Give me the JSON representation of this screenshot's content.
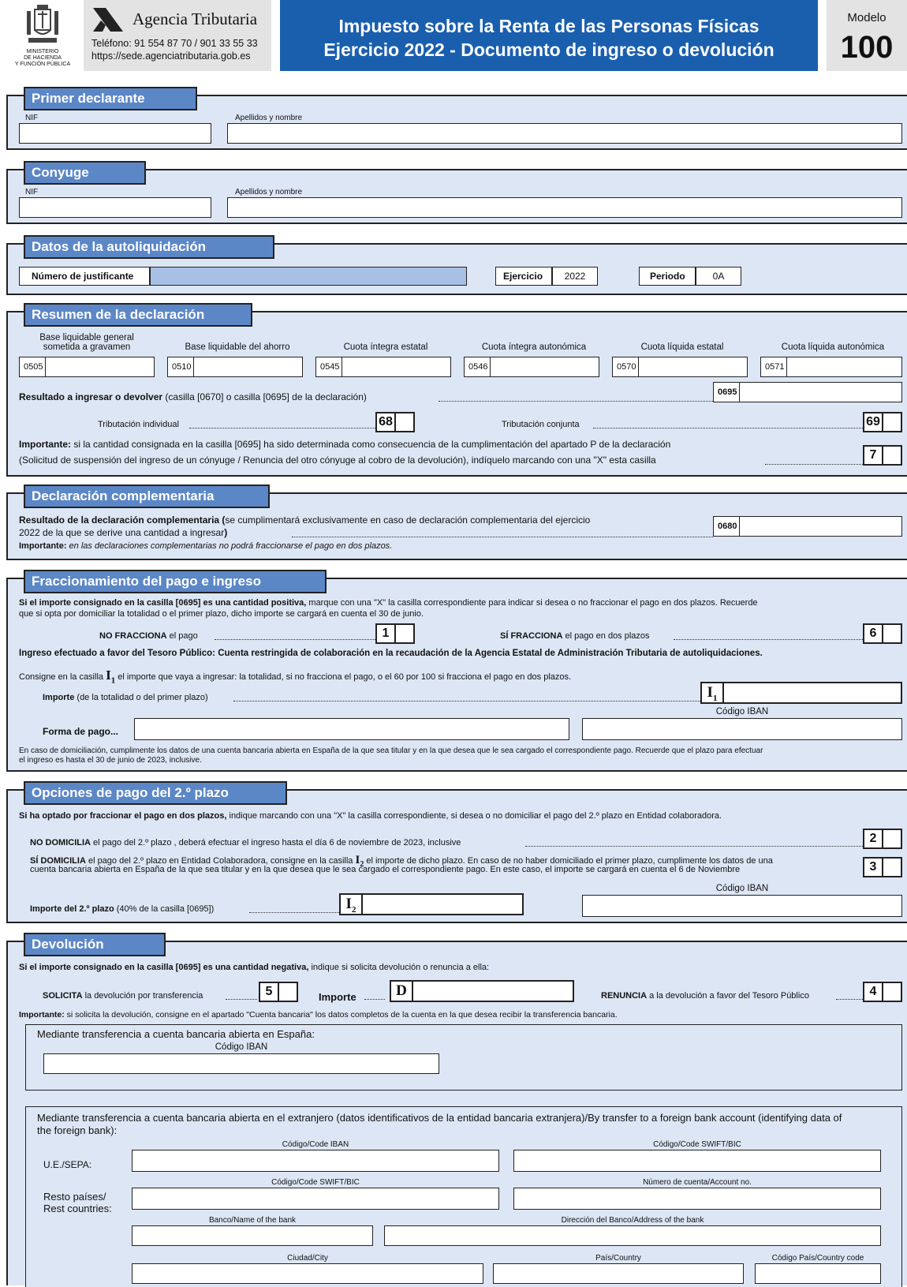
{
  "header": {
    "ministry_line1": "MINISTERIO",
    "ministry_line2": "DE HACIENDA",
    "ministry_line3": "Y FUNCIÓN PÚBLICA",
    "agency_name": "Agencia Tributaria",
    "phone": "Teléfono: 91 554 87 70 / 901 33 55 33",
    "website": "https://sede.agenciatributaria.gob.es",
    "title_line1": "Impuesto sobre la Renta de las Personas Físicas",
    "title_line2": "Ejercicio 2022 - Documento de ingreso o devolución",
    "modelo_label": "Modelo",
    "modelo_number": "100"
  },
  "primer_declarante": {
    "title": "Primer declarante",
    "nif_label": "NIF",
    "name_label": "Apellidos y nombre",
    "nif_value": "",
    "name_value": ""
  },
  "conyuge": {
    "title": "Conyuge",
    "nif_label": "NIF",
    "name_label": "Apellidos y nombre",
    "nif_value": "",
    "name_value": ""
  },
  "autoliquidacion": {
    "title": "Datos de la autoliquidación",
    "justificante_label": "Número de justificante",
    "justificante_value": "",
    "ejercicio_label": "Ejercicio",
    "ejercicio_value": "2022",
    "periodo_label": "Periodo",
    "periodo_value": "0A"
  },
  "resumen": {
    "title": "Resumen de la declaración",
    "fields": [
      {
        "label_1": "Base liquidable general",
        "label_2": "sometida a gravamen",
        "code": "0505",
        "value": ""
      },
      {
        "label_1": "Base liquidable del ahorro",
        "label_2": "",
        "code": "0510",
        "value": ""
      },
      {
        "label_1": "Cuota íntegra estatal",
        "label_2": "",
        "code": "0545",
        "value": ""
      },
      {
        "label_1": "Cuota íntegra autonómica",
        "label_2": "",
        "code": "0546",
        "value": ""
      },
      {
        "label_1": "Cuota líquida estatal",
        "label_2": "",
        "code": "0570",
        "value": ""
      },
      {
        "label_1": "Cuota líquida autonómica",
        "label_2": "",
        "code": "0571",
        "value": ""
      }
    ],
    "resultado_bold": "Resultado a ingresar o devolver",
    "resultado_rest": " (casilla [0670] o casilla [0695] de la declaración)",
    "resultado_code": "0695",
    "resultado_value": "",
    "tributacion_individual": "Tributación individual",
    "tributacion_individual_box": "68",
    "tributacion_conjunta": "Tributación conjunta",
    "tributacion_conjunta_box": "69",
    "importante_bold": "Importante:",
    "importante_line1": " si la cantidad consignada en la casilla [0695] ha sido determinada como consecuencia de la cumplimentación del apartado P de la declaración",
    "importante_line2": "(Solicitud de suspensión del ingreso de un cónyuge / Renuncia del otro cónyuge al cobro de la devolución), indíquelo marcando con una \"X\" esta casilla",
    "importante_box": "7"
  },
  "complementaria": {
    "title": "Declaración complementaria",
    "line1_bold": "Resultado de la declaración complementaria (",
    "line1_rest": "se cumplimentará exclusivamente en caso de declaración complementaria del ejercicio",
    "line2": "2022 de la que se derive una cantidad a ingresar",
    "line2_end": ")",
    "code": "0680",
    "value": "",
    "importante_bold": "Importante:",
    "importante_rest": " en las declaraciones complementarias no podrá fraccionarse el pago en dos plazos."
  },
  "fraccionamiento": {
    "title": "Fraccionamiento del pago e ingreso",
    "intro_bold": "Si el importe consignado en la casilla [0695] es una cantidad positiva,",
    "intro_rest": " marque con una \"X\" la casilla correspondiente para indicar si desea o no fraccionar el pago en dos plazos. Recuerde",
    "intro_line2": "que si opta por domiciliar la totalidad o el primer plazo, dicho importe se cargará en cuenta el 30 de junio.",
    "no_fracciona_bold": "NO FRACCIONA",
    "no_fracciona_rest": " el pago",
    "no_fracciona_box": "1",
    "si_fracciona_bold": "SÍ FRACCIONA",
    "si_fracciona_rest": " el pago en dos plazos",
    "si_fracciona_box": "6",
    "ingreso_line": "Ingreso efectuado a favor del Tesoro Público: Cuenta restringida de colaboración en la recaudación de la Agencia Estatal de Administración Tributaria de autoliquidaciones.",
    "consigne_pre": "Consigne en la casilla ",
    "consigne_post": " el importe que vaya a ingresar: la totalidad, si no fracciona el pago, o el 60 por 100 si fracciona el pago en dos plazos.",
    "importe_bold": "Importe",
    "importe_rest": " (de la totalidad o del primer plazo)",
    "i1_letter": "I",
    "i1_sub": "1",
    "importe_value": "",
    "iban_label": "Código IBAN",
    "iban_value": "",
    "forma_pago_label": "Forma de pago...",
    "forma_pago_value": "",
    "domiciliacion_line1": "En caso de domiciliación, cumplimente los datos de una cuenta bancaria abierta en España de la que sea titular y en la que desea que le sea cargado el correspondiente pago. Recuerde que el plazo para efectuar",
    "domiciliacion_line2": "el ingreso es hasta el 30 de junio de 2023, inclusive."
  },
  "segundo_plazo": {
    "title": "Opciones de pago del 2.º plazo",
    "intro_bold": "Si ha optado por fraccionar el pago en dos plazos,",
    "intro_rest": " indique marcando con una \"X\" la casilla correspondiente, si desea o no domiciliar el pago del 2.º plazo en Entidad colaboradora.",
    "no_domicilia_bold": "NO DOMICILIA",
    "no_domicilia_rest": " el pago del 2.º plazo , deberá efectuar el ingreso hasta el día 6 de noviembre de 2023, inclusive",
    "no_domicilia_box": "2",
    "si_domicilia_bold": "SÍ DOMICILIA",
    "si_domicilia_rest1": " el pago del 2.º plazo en Entidad Colaboradora, consigne en la casilla ",
    "si_domicilia_rest2": " el importe de dicho plazo. En caso de no haber domiciliado el primer plazo, cumplimente los datos de una",
    "si_domicilia_line2": "cuenta bancaria abierta en España de la que sea titular y en la que desea que le sea cargado el correspondiente pago. En este caso, el importe se cargará en cuenta el 6 de Noviembre",
    "si_domicilia_box": "3",
    "i2_letter": "I",
    "i2_sub": "2",
    "importe_bold": "Importe del 2.º plazo",
    "importe_rest": " (40% de la casilla [0695])",
    "importe_value": "",
    "iban_label": "Código IBAN",
    "iban_value": ""
  },
  "devolucion": {
    "title": "Devolución",
    "intro_bold": "Si el importe consignado en la casilla [0695] es una cantidad negativa,",
    "intro_rest": " indique si solicita devolución o renuncia a ella:",
    "solicita_bold": "SOLICITA",
    "solicita_rest": " la devolución por transferencia",
    "solicita_box": "5",
    "importe_label": "Importe",
    "d_letter": "D",
    "importe_value": "",
    "renuncia_bold": "RENUNCIA",
    "renuncia_rest": " a la devolución a favor del Tesoro Público",
    "renuncia_box": "4",
    "importante_bold": "Importante:",
    "importante_rest": " si solicita la devolución, consigne en el apartado \"Cuenta bancaria\" los datos completos de la cuenta en la que desea recibir la transferencia bancaria.",
    "espana_label": "Mediante transferencia a cuenta bancaria abierta en España:",
    "espana_iban_label": "Código IBAN",
    "espana_iban_value": "",
    "extranjero_line1": "Mediante transferencia a cuenta bancaria abierta en el extranjero (datos identificativos de la entidad bancaria extranjera)/By transfer to a foreign bank account (identifying data of",
    "extranjero_line2": "the foreign bank):",
    "ue_label": "U.E./SEPA:",
    "iban_label": "Código/Code IBAN",
    "swift_label": "Código/Code SWIFT/BIC",
    "resto_label1": "Resto países/",
    "resto_label2": "Rest countries:",
    "swift2_label": "Código/Code SWIFT/BIC",
    "account_label": "Número de cuenta/Account no.",
    "bank_name_label": "Banco/Name of the bank",
    "bank_address_label": "Dirección del Banco/Address of the bank",
    "city_label": "Ciudad/City",
    "country_label": "País/Country",
    "country_code_label": "Código País/Country code"
  }
}
